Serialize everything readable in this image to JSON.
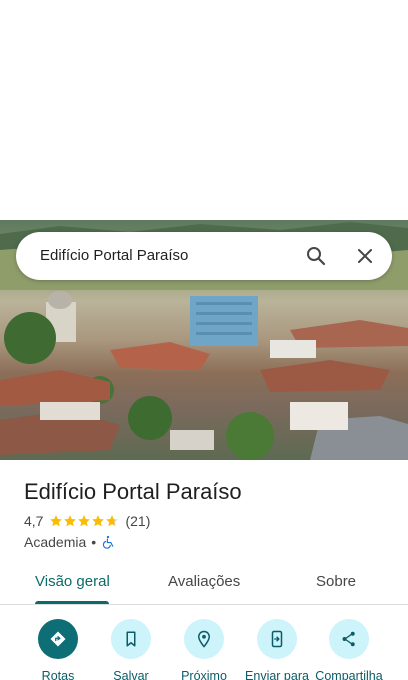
{
  "search": {
    "query": "Edifício Portal Paraíso"
  },
  "place": {
    "name": "Edifício Portal Paraíso",
    "rating": "4,7",
    "stars": 4.7,
    "review_count": "(21)",
    "category": "Academia",
    "separator": "•"
  },
  "tabs": [
    {
      "label": "Visão geral",
      "active": true
    },
    {
      "label": "Avaliações",
      "active": false
    },
    {
      "label": "Sobre",
      "active": false
    }
  ],
  "actions": [
    {
      "label": "Rotas",
      "icon": "directions-icon"
    },
    {
      "label": "Salvar",
      "icon": "bookmark-icon"
    },
    {
      "label": "Próximo",
      "icon": "nearby-icon"
    },
    {
      "label": "Enviar para",
      "icon": "send-to-phone-icon"
    },
    {
      "label": "Compartilha",
      "icon": "share-icon"
    }
  ],
  "colors": {
    "accent": "#0b6b6b",
    "action_bg": "#cdf3fb",
    "primary_action_bg": "#0e6e75",
    "star": "#fbbc04",
    "wheelchair": "#1a73e8"
  }
}
